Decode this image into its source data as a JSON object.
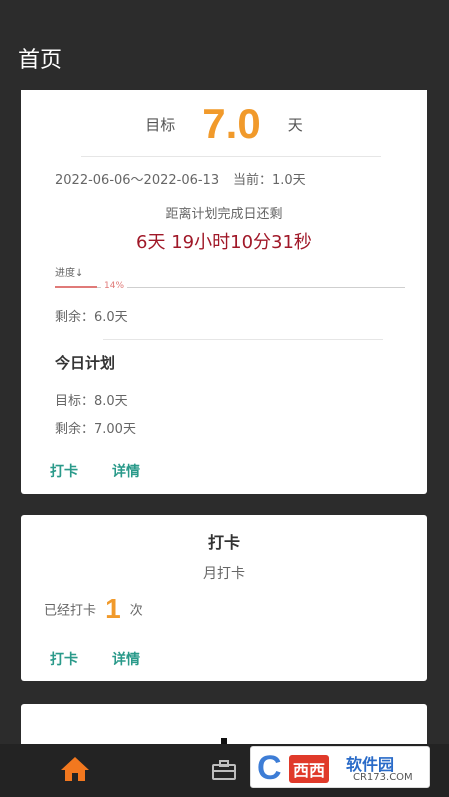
{
  "app": {
    "title": "首页"
  },
  "plan": {
    "goal_label": "目标",
    "goal_value": "7.0",
    "goal_unit": "天",
    "date_range": "2022-06-06～2022-06-13",
    "current": "当前：1.0天",
    "countdown_label": "距离计划完成日还剩",
    "countdown_value": "6天 19小时10分31秒",
    "progress_label": "进度↓",
    "progress_percent_text": "14%",
    "progress_fraction": 0.14,
    "remaining": "剩余：6.0天",
    "today_title": "今日计划",
    "today_goal": "目标：8.0天",
    "today_remaining": "剩余：7.00天",
    "checkin_link": "打卡",
    "details_link": "详情"
  },
  "checkin_card": {
    "title": "打卡",
    "subtitle": "月打卡",
    "count_prefix": "已经打卡",
    "count_value": "1",
    "count_suffix": "次",
    "checkin_link": "打卡",
    "details_link": "详情"
  },
  "watermark": {
    "logo_letter": "C",
    "logo_mid": "西西",
    "name": "软件园",
    "site": "CR173.COM"
  },
  "colors": {
    "accent_orange": "#f19a2b",
    "countdown_red": "#a01828",
    "link_teal": "#2a9a8a",
    "progress_pink": "#e07a78"
  },
  "icons": [
    "home-icon",
    "briefcase-icon"
  ]
}
